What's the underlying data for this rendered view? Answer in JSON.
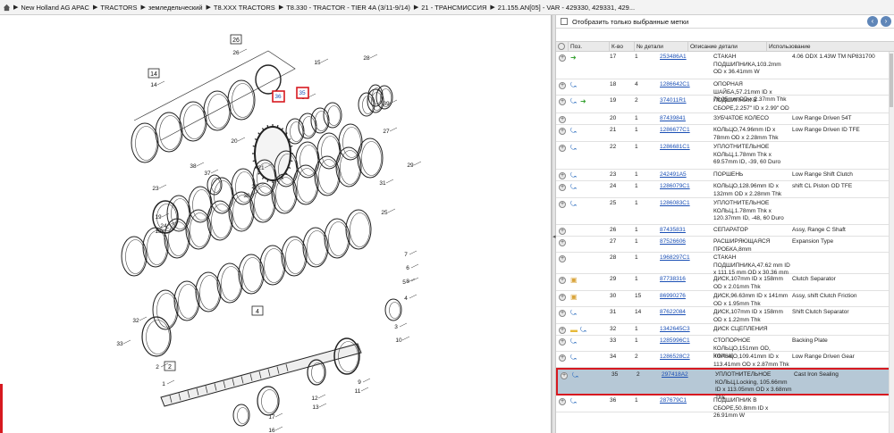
{
  "breadcrumb": [
    "New Holland AG APAC",
    "TRACTORS",
    "земледельческий",
    "T8.XXX TRACTORS",
    "T8.330 - TRACTOR - TIER 4A (3/11-9/14)",
    "21 - ТРАНСМИССИЯ",
    "21.155.AN[05] - VAR - 429330, 429331, 429..."
  ],
  "filter": {
    "label": "Отобразить только выбранные метки"
  },
  "columns": {
    "pos": "Поз.",
    "qty": "К-во",
    "part": "№ детали",
    "desc": "Описание детали",
    "usage": "Использование"
  },
  "rows": [
    {
      "pos": "17",
      "qty": "1",
      "part": "253486A1",
      "desc": "СТАКАН ПОДШИПНИКА,103.2mm OD x 36.41mm W",
      "usage": "4.06 ODX 1.43W TM NP831700",
      "icons": [
        "plus",
        "fwd"
      ]
    },
    {
      "pos": "18",
      "qty": "4",
      "part": "1286642C1",
      "desc": "ОПОРНАЯ ШАЙБА,57.21mm ID x 76.05mm OD x 2.37mm Thk",
      "usage": "",
      "icons": [
        "plus",
        "link"
      ]
    },
    {
      "pos": "19",
      "qty": "2",
      "part": "374011R1",
      "desc": "ПОДШИПНИК В СБОРЕ,2.257\" ID x 2.99\" OD",
      "usage": "",
      "icons": [
        "plus",
        "link",
        "fwd"
      ]
    },
    {
      "pos": "20",
      "qty": "1",
      "part": "87439841",
      "desc": "ЗУБЧАТОЕ КОЛЕСО",
      "usage": "Low Range Driven 54T",
      "icons": [
        "plus"
      ]
    },
    {
      "pos": "21",
      "qty": "1",
      "part": "1286677C1",
      "desc": "КОЛЬЦО,74.96mm ID x 78mm OD x 2.28mm Thk",
      "usage": "Low Range Driven ID TFE",
      "icons": [
        "plus",
        "link"
      ]
    },
    {
      "pos": "22",
      "qty": "1",
      "part": "1286681C1",
      "desc": "УПЛОТНИТЕЛЬНОЕ КОЛЬЦ,1.78mm Thk x 69.57mm ID, -39, 60 Duro",
      "usage": "",
      "icons": [
        "plus",
        "link"
      ]
    },
    {
      "pos": "23",
      "qty": "1",
      "part": "242491A5",
      "desc": "ПОРШЕНЬ",
      "usage": "Low Range Shift Clutch",
      "icons": [
        "plus",
        "link"
      ]
    },
    {
      "pos": "24",
      "qty": "1",
      "part": "1286079C1",
      "desc": "КОЛЬЦО,128.96mm ID x 132mm OD x 2.28mm Thk",
      "usage": "shift CL Piston OD TFE",
      "icons": [
        "plus",
        "link"
      ]
    },
    {
      "pos": "25",
      "qty": "1",
      "part": "1286083C1",
      "desc": "УПЛОТНИТЕЛЬНОЕ КОЛЬЦ,1.78mm Thk x 120.37mm ID, -48, 60 Duro",
      "usage": "",
      "icons": [
        "plus",
        "link"
      ]
    },
    {
      "pos": "26",
      "qty": "1",
      "part": "87435831",
      "desc": "СЕПАРАТОР",
      "usage": "Assy, Range C Shaft",
      "icons": [
        "plus"
      ]
    },
    {
      "pos": "27",
      "qty": "1",
      "part": "87526606",
      "desc": "РАСШИРЯЮЩАЯСЯ ПРОБКА,8mm",
      "usage": "Expansion Type",
      "icons": [
        "plus"
      ]
    },
    {
      "pos": "28",
      "qty": "1",
      "part": "1968297C1",
      "desc": "СТАКАН ПОДШИПНИКА,47.62 mm ID x 111.15 mm OD x 30.36 mm",
      "usage": "",
      "icons": [
        "plus"
      ]
    },
    {
      "pos": "29",
      "qty": "1",
      "part": "87738316",
      "desc": "ДИСК,107mm ID x 158mm OD x 2.01mm Thk",
      "usage": "Clutch Separator",
      "icons": [
        "plus",
        "box"
      ]
    },
    {
      "pos": "30",
      "qty": "15",
      "part": "86990276",
      "desc": "ДИСК,96.63mm ID x 141mm OD x 1.95mm Thk",
      "usage": "Assy, shift Clutch Friction",
      "icons": [
        "plus",
        "box"
      ]
    },
    {
      "pos": "31",
      "qty": "14",
      "part": "87622084",
      "desc": "ДИСК,107mm ID x 158mm OD x 1.22mm Thk",
      "usage": "Shift Clutch Separator",
      "icons": [
        "plus",
        "link"
      ]
    },
    {
      "pos": "32",
      "qty": "1",
      "part": "1342645C3",
      "desc": "ДИСК СЦЕПЛЕНИЯ",
      "usage": "",
      "icons": [
        "plus",
        "folder",
        "link"
      ]
    },
    {
      "pos": "33",
      "qty": "1",
      "part": "1285996C1",
      "desc": "СТОПОРНОЕ КОЛЬЦО,151mm OD, Internal",
      "usage": "Backing Plate",
      "icons": [
        "plus",
        "link"
      ]
    },
    {
      "pos": "34",
      "qty": "2",
      "part": "1286528C2",
      "desc": "КОЛЬЦО,109.41mm ID x 113.41mm OD x 2.87mm Thk",
      "usage": "Low Range Driven Gear",
      "icons": [
        "plus",
        "link"
      ]
    },
    {
      "pos": "35",
      "qty": "2",
      "part": "297418A2",
      "desc": "УПЛОТНИТЕЛЬНОЕ КОЛЬЦ,Locking, 105.66mm ID x 113.05mm OD x 3.68mm Thk",
      "usage": "Cast Iron Sealing",
      "icons": [
        "plus",
        "link"
      ],
      "selected": true
    },
    {
      "pos": "36",
      "qty": "1",
      "part": "287679C1",
      "desc": "ПОДШИПНИК В СБОРЕ,50.8mm ID x 26.91mm W",
      "usage": "",
      "icons": [
        "plus",
        "link"
      ]
    }
  ],
  "diagram": {
    "callouts": [
      "1",
      "2",
      "3",
      "4",
      "5",
      "6",
      "7",
      "8",
      "9",
      "10",
      "11",
      "12",
      "13",
      "14",
      "15",
      "16",
      "17",
      "18",
      "19",
      "20",
      "21",
      "22",
      "23",
      "24",
      "25",
      "26",
      "27",
      "28",
      "29",
      "30",
      "31",
      "32",
      "33",
      "34",
      "35",
      "36",
      "37",
      "38",
      "39"
    ],
    "highlighted": [
      "35",
      "36"
    ],
    "box_labels": [
      "26",
      "14",
      "4",
      "2"
    ]
  },
  "colors": {
    "selection": "#b6c8d6",
    "highlight_border": "#d71920",
    "link": "#1a4fb5",
    "button": "#5f86b8"
  }
}
